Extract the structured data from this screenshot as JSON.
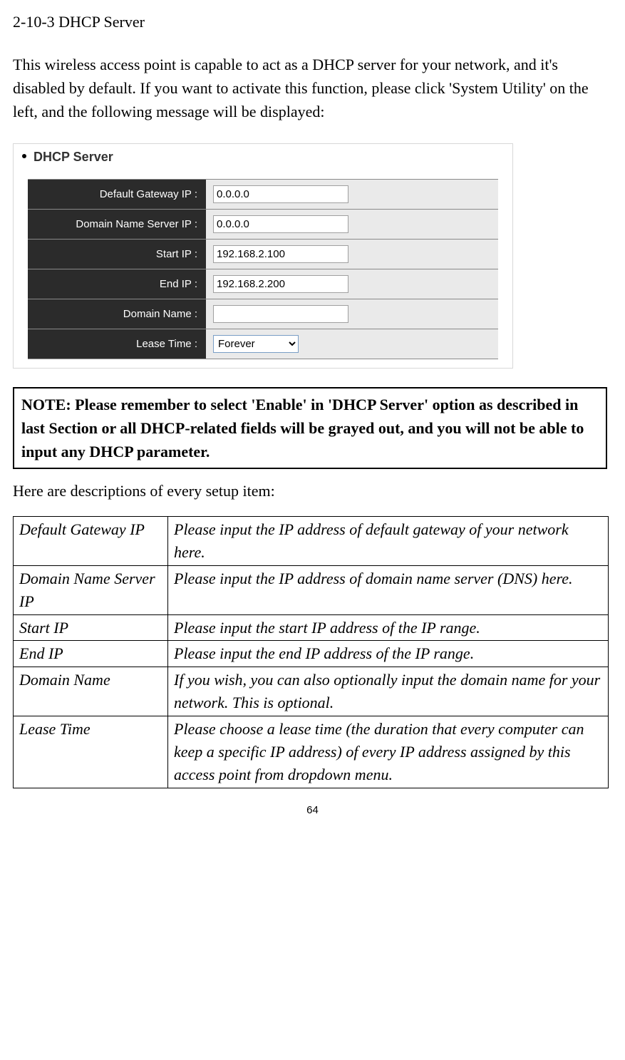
{
  "section_title": "2-10-3 DHCP Server",
  "intro": "This wireless access point is capable to act as a DHCP server for your network, and it's disabled by default. If you want to activate this function, please click 'System Utility' on the left, and the following message will be displayed:",
  "dhcp": {
    "heading": "DHCP Server",
    "fields": {
      "gateway": {
        "label": "Default Gateway IP :",
        "value": "0.0.0.0"
      },
      "dns": {
        "label": "Domain Name Server IP :",
        "value": "0.0.0.0"
      },
      "start": {
        "label": "Start IP :",
        "value": "192.168.2.100"
      },
      "end": {
        "label": "End IP :",
        "value": "192.168.2.200"
      },
      "domain": {
        "label": "Domain Name :",
        "value": ""
      },
      "lease": {
        "label": "Lease Time :",
        "value": "Forever"
      }
    }
  },
  "note": "NOTE: Please remember to select 'Enable' in 'DHCP Server' option as described in last Section or all DHCP-related fields will be grayed out, and you will not be able to input any DHCP parameter.",
  "desc_intro": "Here are descriptions of every setup item:",
  "table": [
    {
      "name": "Default Gateway IP",
      "desc": "Please input the IP address of default gateway of your network here."
    },
    {
      "name": "Domain Name Server IP",
      "desc": "Please input the IP address of domain name server (DNS) here."
    },
    {
      "name": "Start IP",
      "desc": "Please input the start IP address of the IP range."
    },
    {
      "name": "End IP",
      "desc": "Please input the end IP address of the IP range."
    },
    {
      "name": "Domain Name",
      "desc": "If you wish, you can also optionally input the domain name for your network. This is optional."
    },
    {
      "name": "Lease Time",
      "desc": "Please choose a lease time (the duration that every computer can keep a specific IP address) of every IP address assigned by this access point from dropdown menu."
    }
  ],
  "page_number": "64"
}
